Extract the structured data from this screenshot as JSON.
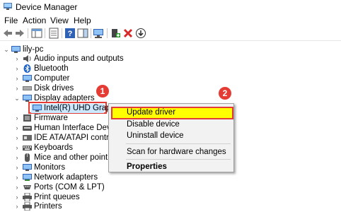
{
  "window": {
    "title": "Device Manager"
  },
  "menu": [
    "File",
    "Action",
    "View",
    "Help"
  ],
  "tree": {
    "root": "lily-pc",
    "items": [
      {
        "label": "Audio inputs and outputs",
        "icon": "speaker-icon",
        "expanded": false
      },
      {
        "label": "Bluetooth",
        "icon": "bluetooth-icon",
        "expanded": false
      },
      {
        "label": "Computer",
        "icon": "computer-icon",
        "expanded": false
      },
      {
        "label": "Disk drives",
        "icon": "disk-icon",
        "expanded": false
      },
      {
        "label": "Display adapters",
        "icon": "monitor-icon",
        "expanded": true
      },
      {
        "label": "Intel(R) UHD Graphics",
        "icon": "display-adapter-icon",
        "child": true,
        "selected": true
      },
      {
        "label": "Firmware",
        "icon": "chip-icon",
        "expanded": false
      },
      {
        "label": "Human Interface Devices",
        "icon": "hid-icon",
        "expanded": false
      },
      {
        "label": "IDE ATA/ATAPI controllers",
        "icon": "controller-icon",
        "expanded": false
      },
      {
        "label": "Keyboards",
        "icon": "keyboard-icon",
        "expanded": false
      },
      {
        "label": "Mice and other pointing d",
        "icon": "mouse-icon",
        "expanded": false
      },
      {
        "label": "Monitors",
        "icon": "monitor-icon",
        "expanded": false
      },
      {
        "label": "Network adapters",
        "icon": "network-icon",
        "expanded": false
      },
      {
        "label": "Ports (COM & LPT)",
        "icon": "port-icon",
        "expanded": false
      },
      {
        "label": "Print queues",
        "icon": "printer-icon",
        "expanded": false
      },
      {
        "label": "Printers",
        "icon": "printer-icon",
        "expanded": false
      }
    ]
  },
  "context_menu": {
    "update_driver": "Update driver",
    "disable_device": "Disable device",
    "uninstall_device": "Uninstall device",
    "scan_hardware": "Scan for hardware changes",
    "properties": "Properties"
  },
  "callouts": {
    "one": "1",
    "two": "2"
  },
  "colors": {
    "highlight": "#ffff00",
    "callout": "#e53b35",
    "selection": "#cce8ff"
  }
}
